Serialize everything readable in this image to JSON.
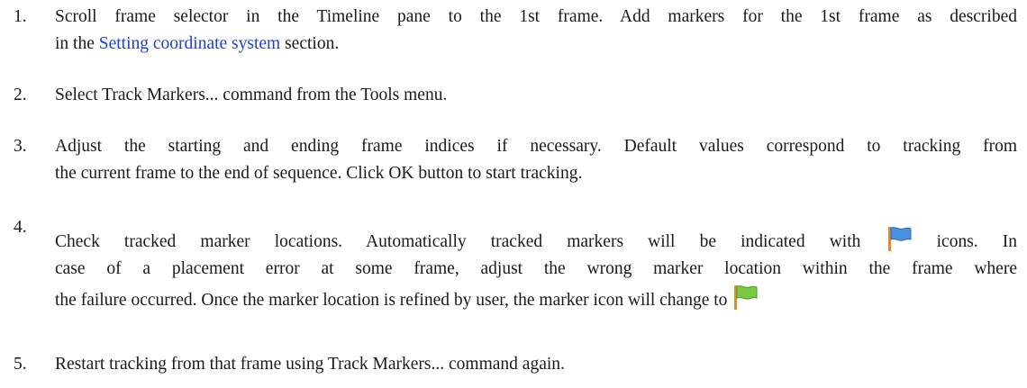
{
  "steps": [
    {
      "number": "1.",
      "lines": [
        {
          "text": "Scroll frame selector in the Timeline pane to the 1st frame. Add markers for the 1st frame as described"
        },
        {
          "prefix": "in the ",
          "link": "Setting coordinate system",
          "suffix": " section."
        }
      ]
    },
    {
      "number": "2.",
      "lines": [
        {
          "text": "Select Track Markers... command from the Tools menu."
        }
      ]
    },
    {
      "number": "3.",
      "lines": [
        {
          "text": "Adjust the starting and ending frame indices if necessary. Default values correspond to tracking from"
        },
        {
          "text": "the current frame to the end of sequence. Click OK button to start tracking."
        }
      ]
    },
    {
      "number": "4.",
      "lines": [
        {
          "prefix": "Check tracked marker locations. Automatically tracked markers will be indicated with",
          "icon": "blue-flag-icon",
          "suffix": "icons. In"
        },
        {
          "text": "case of a placement error at some frame, adjust the wrong marker location within the frame where"
        },
        {
          "prefix": "the failure occurred. Once the marker location is refined by user, the marker icon will change to",
          "icon": "green-flag-icon"
        }
      ]
    },
    {
      "number": "5.",
      "lines": [
        {
          "text": "Restart tracking from that frame using Track Markers... command again."
        }
      ]
    }
  ],
  "colors": {
    "link": "#1f3fd6",
    "text": "#1a1a1a",
    "blue_flag": "#4a90e2",
    "green_flag": "#7ac943",
    "flag_pole": "#e08a2a"
  }
}
